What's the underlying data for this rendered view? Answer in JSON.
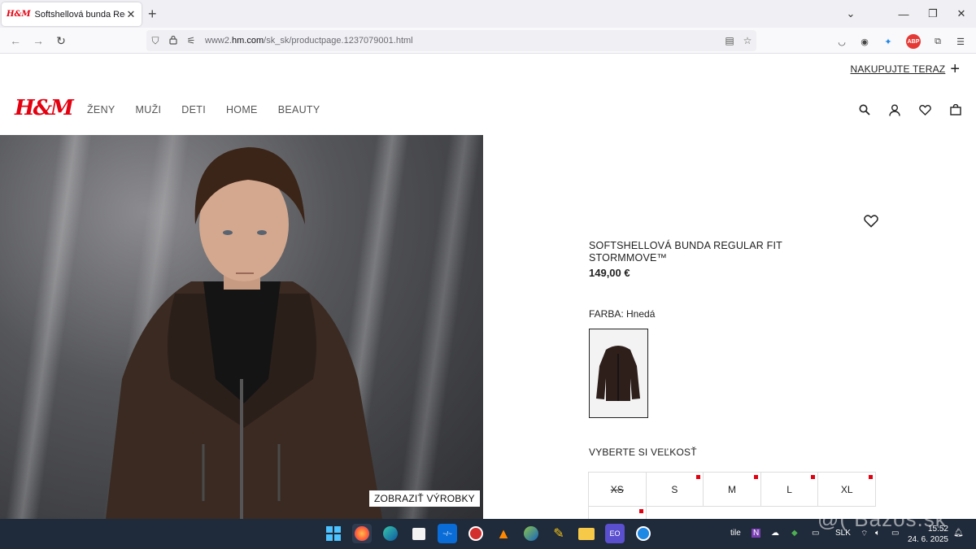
{
  "browser": {
    "tab_title": "Softshellová bunda Regular Fit",
    "tab_favicon": "H&M",
    "url_prefix": "www2.",
    "url_domain": "hm.com",
    "url_path": "/sk_sk/productpage.1237079001.html"
  },
  "page": {
    "shop_now_label": "NAKUPUJTE TERAZ",
    "logo_text": "H&M",
    "menu": [
      "ŽENY",
      "MUŽI",
      "DETI",
      "HOME",
      "BEAUTY"
    ],
    "show_products_label": "ZOBRAZIŤ VÝROBKY",
    "product": {
      "title": "SOFTSHELLOVÁ BUNDA REGULAR FIT STORMMOVE™",
      "price": "149,00 €",
      "color_label": "FARBA: Hnedá",
      "size_label": "VYBERTE SI VEĽKOSŤ",
      "sizes": [
        {
          "label": "XS",
          "out_of_stock": true,
          "low_stock": false
        },
        {
          "label": "S",
          "out_of_stock": false,
          "low_stock": true
        },
        {
          "label": "M",
          "out_of_stock": false,
          "low_stock": true
        },
        {
          "label": "L",
          "out_of_stock": false,
          "low_stock": true
        },
        {
          "label": "XL",
          "out_of_stock": false,
          "low_stock": true
        }
      ]
    }
  },
  "taskbar": {
    "language": "SLK",
    "time": "15:52",
    "date": "24. 6. 2025",
    "tray_label": "tile"
  },
  "watermark": "@( Bazos.sk",
  "colors": {
    "brand_red": "#e50010",
    "taskbar_bg": "#1f2a3a",
    "jacket_brown": "#3a2a22"
  }
}
